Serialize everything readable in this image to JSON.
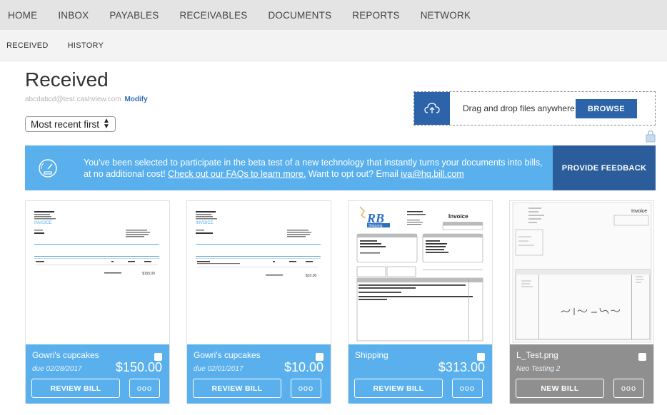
{
  "topnav": {
    "items": [
      "HOME",
      "INBOX",
      "PAYABLES",
      "RECEIVABLES",
      "DOCUMENTS",
      "REPORTS",
      "NETWORK"
    ]
  },
  "subnav": {
    "items": [
      "RECEIVED",
      "HISTORY"
    ]
  },
  "page": {
    "title": "Received",
    "email": "abcdabcd@test.cashview.com",
    "modify_label": "Modify",
    "sort_value": "Most recent first"
  },
  "upload": {
    "drop_text": "Drag and drop files anywhere or",
    "browse_label": "BROWSE",
    "icon": "cloud-upload-icon"
  },
  "banner": {
    "text_before": "You've been selected to participate in the beta test of a new technology that instantly turns your documents into bills, at no additional cost!",
    "faq_link": "Check out our FAQs to learn more.",
    "text_mid": "Want to opt out? Email",
    "email_link": "iva@hq.bill.com",
    "feedback_label": "PROVIDE FEEDBACK",
    "icon": "gauge-icon",
    "color": "#5ab0ec"
  },
  "cards": [
    {
      "vendor": "Gowri's cupcakes",
      "due": "due 02/28/2017",
      "amount": "$150.00",
      "action_label": "REVIEW BILL",
      "more_label": "ooo",
      "doc": {
        "heading": "INVOICE",
        "total": "$150.00"
      }
    },
    {
      "vendor": "Gowri's cupcakes",
      "due": "due 02/01/2017",
      "amount": "$10.00",
      "action_label": "REVIEW BILL",
      "more_label": "ooo",
      "doc": {
        "heading": "INVOICE",
        "total": "$10.00"
      }
    },
    {
      "vendor": "Shipping",
      "due": "",
      "amount": "$313.00",
      "action_label": "REVIEW BILL",
      "more_label": "ooo",
      "doc": {
        "logo": "RB",
        "logo_sub": "Shipping",
        "heading": "Invoice"
      }
    },
    {
      "vendor": "L_Test.png",
      "due": "Neo Testing 2",
      "amount": "",
      "action_label": "NEW BILL",
      "more_label": "ooo",
      "doc": {
        "heading": "Invoice"
      }
    }
  ],
  "colors": {
    "accent": "#5ab0ec",
    "brand_dark": "#2c63a9",
    "feedback_bg": "#2c5d9b",
    "gray_card": "#8f8f8f"
  }
}
